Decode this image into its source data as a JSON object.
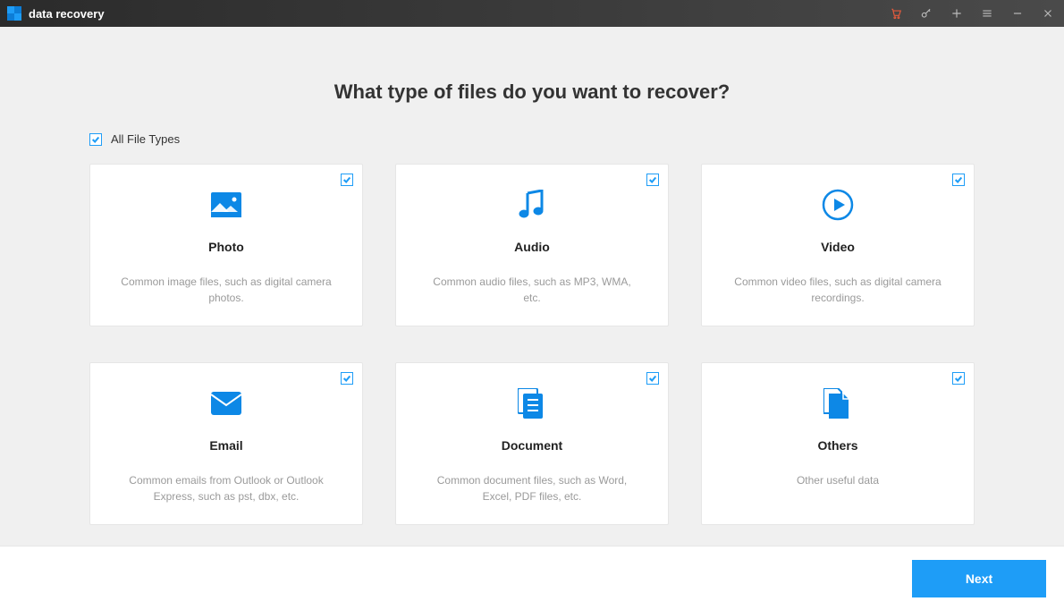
{
  "app": {
    "title": "data recovery"
  },
  "main": {
    "heading": "What type of files do you want to recover?",
    "all_label": "All File Types",
    "cards": {
      "photo": {
        "title": "Photo",
        "desc": "Common image files, such as digital camera photos."
      },
      "audio": {
        "title": "Audio",
        "desc": "Common audio files, such as MP3, WMA, etc."
      },
      "video": {
        "title": "Video",
        "desc": "Common video files, such as digital camera recordings."
      },
      "email": {
        "title": "Email",
        "desc": "Common emails from Outlook or Outlook Express, such as pst, dbx, etc."
      },
      "document": {
        "title": "Document",
        "desc": "Common document files, such as Word, Excel, PDF files, etc."
      },
      "others": {
        "title": "Others",
        "desc": "Other useful data"
      }
    }
  },
  "footer": {
    "next": "Next"
  },
  "colors": {
    "accent": "#1e9df7"
  }
}
